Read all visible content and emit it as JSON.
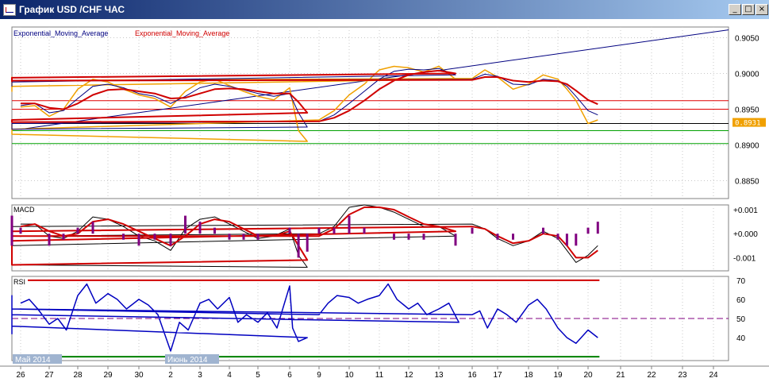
{
  "window": {
    "title": "График USD /CHF ЧАС",
    "minimize_glyph": "_",
    "restore_glyph": "□",
    "close_glyph": "×"
  },
  "colors": {
    "price": "#f0a000",
    "ema_fast": "#000080",
    "ema_slow": "#d00000",
    "trendline": "#000080",
    "hline_red": "#e00000",
    "hline_green": "#00a000",
    "hline_black": "#000000",
    "macd_line": "#000000",
    "macd_signal": "#d00000",
    "macd_hist": "#800080",
    "rsi": "#0000c0",
    "rsi_70": "#d00000",
    "rsi_30": "#008000",
    "rsi_50": "#800080",
    "price_tag_bg": "#f0a000",
    "date_badge_bg": "#a0b4d0"
  },
  "chart_data": [
    {
      "type": "line",
      "panel": "price",
      "legend": [
        "Exponential_Moving_Average",
        "Exponential_Moving_Average"
      ],
      "y_ticks": [
        "0.9050",
        "0.9000",
        "0.8950",
        "0.8900",
        "0.8850"
      ],
      "ylim": [
        0.8825,
        0.9065
      ],
      "current_price_label": "0.8931",
      "current_price": 0.8931,
      "horizontal_levels": [
        {
          "value": 0.8962,
          "color": "red"
        },
        {
          "value": 0.895,
          "color": "red"
        },
        {
          "value": 0.893,
          "color": "black"
        },
        {
          "value": 0.892,
          "color": "green"
        },
        {
          "value": 0.8902,
          "color": "green"
        }
      ],
      "trendline": {
        "from": {
          "day": 26.0,
          "value": 0.8922
        },
        "to": {
          "day": 24.45,
          "value": 0.9061
        }
      },
      "series": [
        {
          "role": "price",
          "x": [
            26.0,
            26.5,
            27.0,
            27.5,
            28.0,
            28.5,
            29.0,
            29.5,
            30.0,
            30.5,
            2.0,
            2.5,
            3.0,
            3.5,
            4.0,
            4.5,
            5.0,
            5.5,
            6.0,
            6.3,
            6.6,
            7.0,
            7.5,
            8.0,
            8.5,
            9.0,
            9.5,
            10.0,
            10.5,
            11.0,
            11.5,
            12.0,
            12.5,
            13.0,
            13.5,
            14.0,
            14.5,
            15.0,
            15.5,
            16.0,
            16.5,
            17.0,
            17.5,
            18.0,
            18.5,
            19.0,
            19.3,
            19.6,
            20.0,
            20.3
          ],
          "values": [
            0.8953,
            0.8955,
            0.894,
            0.895,
            0.8978,
            0.8992,
            0.8988,
            0.8978,
            0.897,
            0.8965,
            0.8953,
            0.8975,
            0.8988,
            0.8992,
            0.8983,
            0.8975,
            0.8968,
            0.8963,
            0.898,
            0.892,
            0.8905,
            0.8915,
            0.893,
            0.893,
            0.8922,
            0.8935,
            0.8948,
            0.897,
            0.8985,
            0.9005,
            0.901,
            0.9008,
            0.9002,
            0.901,
            0.8992,
            0.8982,
            0.8975,
            0.8995,
            0.899,
            0.8993,
            0.9005,
            0.8995,
            0.8978,
            0.8985,
            0.8998,
            0.8992,
            0.8978,
            0.8962,
            0.893,
            0.8935
          ]
        },
        {
          "role": "ema_fast",
          "x": [
            26.0,
            26.5,
            27.0,
            27.5,
            28.0,
            28.5,
            29.0,
            29.5,
            30.0,
            30.5,
            2.0,
            2.5,
            3.0,
            3.5,
            4.0,
            4.5,
            5.0,
            5.5,
            6.0,
            6.3,
            6.6,
            7.0,
            7.5,
            8.0,
            8.5,
            9.0,
            9.5,
            10.0,
            10.5,
            11.0,
            11.5,
            12.0,
            12.5,
            13.0,
            13.5,
            14.0,
            14.5,
            15.0,
            15.5,
            16.0,
            16.5,
            17.0,
            17.5,
            18.0,
            18.5,
            19.0,
            19.3,
            19.6,
            20.0,
            20.3
          ],
          "values": [
            0.8955,
            0.8958,
            0.8945,
            0.8948,
            0.8965,
            0.8982,
            0.8985,
            0.898,
            0.8972,
            0.8968,
            0.8958,
            0.8968,
            0.898,
            0.8985,
            0.8982,
            0.8977,
            0.8972,
            0.8968,
            0.8972,
            0.8945,
            0.8925,
            0.8922,
            0.8928,
            0.8932,
            0.893,
            0.8933,
            0.8942,
            0.8958,
            0.8975,
            0.8992,
            0.9003,
            0.9006,
            0.9005,
            0.9007,
            0.8998,
            0.8988,
            0.8982,
            0.8988,
            0.899,
            0.8992,
            0.8999,
            0.8996,
            0.8985,
            0.8984,
            0.8992,
            0.899,
            0.8982,
            0.8968,
            0.8948,
            0.8942
          ]
        },
        {
          "role": "ema_slow",
          "x": [
            26.0,
            26.5,
            27.0,
            27.5,
            28.0,
            28.5,
            29.0,
            29.5,
            30.0,
            30.5,
            2.0,
            2.5,
            3.0,
            3.5,
            4.0,
            4.5,
            5.0,
            5.5,
            6.0,
            6.3,
            6.6,
            7.0,
            7.5,
            8.0,
            8.5,
            9.0,
            9.5,
            10.0,
            10.5,
            11.0,
            11.5,
            12.0,
            12.5,
            13.0,
            13.5,
            14.0,
            14.5,
            15.0,
            15.5,
            16.0,
            16.5,
            17.0,
            17.5,
            18.0,
            18.5,
            19.0,
            19.3,
            19.6,
            20.0,
            20.3
          ],
          "values": [
            0.8958,
            0.8958,
            0.8952,
            0.895,
            0.8958,
            0.897,
            0.8977,
            0.8978,
            0.8975,
            0.8972,
            0.8965,
            0.8966,
            0.8972,
            0.8978,
            0.8979,
            0.8978,
            0.8975,
            0.8972,
            0.8972,
            0.896,
            0.8945,
            0.8935,
            0.8932,
            0.8932,
            0.8932,
            0.8933,
            0.8938,
            0.8948,
            0.8962,
            0.8978,
            0.899,
            0.8998,
            0.9002,
            0.9004,
            0.9,
            0.8994,
            0.8989,
            0.899,
            0.899,
            0.8991,
            0.8995,
            0.8995,
            0.899,
            0.8988,
            0.899,
            0.8989,
            0.8985,
            0.8976,
            0.8963,
            0.8957
          ]
        }
      ]
    },
    {
      "type": "line",
      "panel": "macd",
      "label": "MACD",
      "y_ticks": [
        "+0.001",
        "+0.000",
        "-0.001"
      ],
      "ylim": [
        -0.00155,
        0.0012
      ],
      "series": [
        {
          "role": "macd",
          "x": [
            26.0,
            26.5,
            27.0,
            27.5,
            28.0,
            28.5,
            29.0,
            29.5,
            30.0,
            30.5,
            2.0,
            2.5,
            3.0,
            3.5,
            4.0,
            4.5,
            5.0,
            5.5,
            6.0,
            6.3,
            6.6,
            7.0,
            7.5,
            8.0,
            8.5,
            9.0,
            9.5,
            10.0,
            10.5,
            11.0,
            11.5,
            12.0,
            12.5,
            13.0,
            13.5,
            14.0,
            14.5,
            15.0,
            15.5,
            16.0,
            16.5,
            17.0,
            17.5,
            18.0,
            18.5,
            19.0,
            19.3,
            19.6,
            20.0,
            20.3
          ],
          "values": [
            0.0004,
            0.0004,
            -0.0001,
            -0.0002,
            0.0001,
            0.0007,
            0.0006,
            0.0003,
            -0.0001,
            -0.0003,
            -0.0007,
            0.0002,
            0.0006,
            0.0007,
            0.0004,
            0.0001,
            -0.0002,
            -0.0001,
            0.0002,
            -0.0009,
            -0.0014,
            -0.0013,
            -0.0005,
            0.0,
            -0.0001,
            0.0,
            0.0003,
            0.0011,
            0.0012,
            0.0011,
            0.0009,
            0.0006,
            0.0003,
            0.0003,
            -0.0001,
            -0.0005,
            -0.0006,
            -0.0002,
            0.0003,
            0.0004,
            0.0002,
            -0.0002,
            -0.0005,
            -0.0003,
            0.0001,
            -0.0002,
            -0.0007,
            -0.0012,
            -0.0009,
            -0.0005
          ]
        },
        {
          "role": "signal",
          "x": [
            26.0,
            26.5,
            27.0,
            27.5,
            28.0,
            28.5,
            29.0,
            29.5,
            30.0,
            30.5,
            2.0,
            2.5,
            3.0,
            3.5,
            4.0,
            4.5,
            5.0,
            5.5,
            6.0,
            6.3,
            6.6,
            7.0,
            7.5,
            8.0,
            8.5,
            9.0,
            9.5,
            10.0,
            10.5,
            11.0,
            11.5,
            12.0,
            12.5,
            13.0,
            13.5,
            14.0,
            14.5,
            15.0,
            15.5,
            16.0,
            16.5,
            17.0,
            17.5,
            18.0,
            18.5,
            19.0,
            19.3,
            19.6,
            20.0,
            20.3
          ],
          "values": [
            0.0003,
            0.0004,
            0.0001,
            -0.0001,
            0.0,
            0.0005,
            0.0006,
            0.0004,
            0.0001,
            -0.0002,
            -0.0005,
            -0.0001,
            0.0004,
            0.0006,
            0.0005,
            0.0002,
            -0.0001,
            -0.0001,
            0.0001,
            -0.0005,
            -0.0011,
            -0.0013,
            -0.0008,
            -0.0003,
            -0.0001,
            -0.0001,
            0.0002,
            0.0008,
            0.0011,
            0.0011,
            0.001,
            0.0007,
            0.0004,
            0.0003,
            0.0001,
            -0.0003,
            -0.0005,
            -0.0003,
            0.0001,
            0.0003,
            0.0002,
            -0.0001,
            -0.0004,
            -0.0003,
            0.0,
            -0.0001,
            -0.0005,
            -0.001,
            -0.001,
            -0.0007
          ]
        }
      ]
    },
    {
      "type": "line",
      "panel": "rsi",
      "label": "RSI",
      "y_ticks": [
        "70",
        "60",
        "50",
        "40"
      ],
      "ylim": [
        28,
        72
      ],
      "levels": [
        70,
        50,
        30
      ],
      "series": [
        {
          "role": "rsi",
          "x": [
            26.0,
            26.3,
            26.6,
            27.0,
            27.3,
            27.6,
            28.0,
            28.3,
            28.6,
            29.0,
            29.3,
            29.6,
            30.0,
            30.3,
            30.6,
            2.0,
            2.3,
            2.6,
            3.0,
            3.3,
            3.6,
            4.0,
            4.3,
            4.6,
            5.0,
            5.3,
            5.6,
            6.0,
            6.1,
            6.3,
            6.6,
            7.0,
            7.3,
            7.6,
            8.0,
            8.3,
            8.6,
            9.0,
            9.3,
            9.6,
            10.0,
            10.3,
            10.6,
            11.0,
            11.3,
            11.6,
            12.0,
            12.3,
            12.6,
            13.0,
            13.3,
            13.6,
            14.0,
            14.3,
            14.6,
            15.0,
            15.3,
            15.6,
            16.0,
            16.3,
            16.6,
            17.0,
            17.3,
            17.6,
            18.0,
            18.3,
            18.6,
            19.0,
            19.3,
            19.6,
            20.0,
            20.3
          ],
          "values": [
            58,
            60,
            55,
            47,
            50,
            44,
            62,
            68,
            58,
            63,
            60,
            55,
            60,
            57,
            52,
            33,
            48,
            44,
            58,
            60,
            55,
            61,
            48,
            52,
            48,
            53,
            45,
            67,
            45,
            38,
            40,
            46,
            42,
            45,
            48,
            45,
            55,
            52,
            58,
            62,
            61,
            58,
            60,
            62,
            68,
            60,
            55,
            58,
            52,
            55,
            58,
            48,
            52,
            45,
            54,
            62,
            60,
            55,
            52,
            54,
            45,
            55,
            52,
            48,
            57,
            60,
            55,
            45,
            40,
            37,
            44,
            40
          ]
        }
      ]
    }
  ],
  "x_axis": {
    "day_labels": [
      {
        "day": 26.0,
        "text": "26"
      },
      {
        "day": 27.0,
        "text": "27"
      },
      {
        "day": 28.0,
        "text": "28"
      },
      {
        "day": 29.0,
        "text": "29"
      },
      {
        "day": 30.0,
        "text": "30"
      },
      {
        "day": 2.0,
        "text": "2"
      },
      {
        "day": 3.0,
        "text": "3"
      },
      {
        "day": 4.0,
        "text": "4"
      },
      {
        "day": 5.0,
        "text": "5"
      },
      {
        "day": 6.0,
        "text": "6"
      },
      {
        "day": 9.0,
        "text": "9"
      },
      {
        "day": 10.0,
        "text": "10"
      },
      {
        "day": 11.0,
        "text": "11"
      },
      {
        "day": 12.0,
        "text": "12"
      },
      {
        "day": 13.0,
        "text": "13"
      },
      {
        "day": 16.0,
        "text": "16"
      },
      {
        "day": 17.0,
        "text": "17"
      },
      {
        "day": 18.0,
        "text": "18"
      },
      {
        "day": 19.0,
        "text": "19"
      },
      {
        "day": 20.0,
        "text": "20"
      },
      {
        "day": 21.0,
        "text": "21"
      },
      {
        "day": 22.0,
        "text": "22"
      },
      {
        "day": 23.0,
        "text": "23"
      },
      {
        "day": 24.0,
        "text": "24"
      }
    ],
    "month_badges": [
      {
        "text": "Май 2014",
        "day": 26.0
      },
      {
        "text": "Июнь 2014",
        "day": 2.0
      }
    ]
  }
}
